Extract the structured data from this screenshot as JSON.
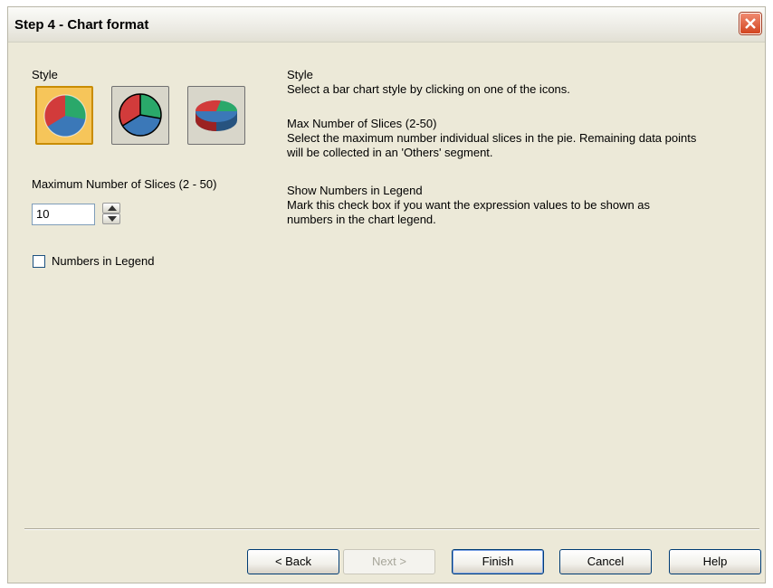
{
  "dialog": {
    "title": "Step 4 - Chart format",
    "close_icon": "close-icon"
  },
  "style": {
    "label": "Style",
    "options": [
      {
        "name": "pie-style-flat-icon",
        "selected": true
      },
      {
        "name": "pie-style-outlined-icon",
        "selected": false
      },
      {
        "name": "pie-style-3d-icon",
        "selected": false
      }
    ]
  },
  "slices": {
    "label": "Maximum Number of Slices (2 - 50)",
    "value": "10"
  },
  "legend": {
    "label": "Numbers in Legend",
    "checked": false
  },
  "help": {
    "style_title": "Style",
    "style_text": "Select a bar chart style by clicking on one of the icons.",
    "slices_title": "Max Number of Slices (2-50)",
    "slices_text_1": "Select the maximum number individual slices in the pie. Remaining data points",
    "slices_text_2": "will be collected in an 'Others' segment.",
    "legend_title": "Show Numbers in Legend",
    "legend_text_1": "Mark this check box if you want the expression values to be shown as",
    "legend_text_2": "numbers in the chart legend."
  },
  "buttons": {
    "back": "< Back",
    "next": "Next >",
    "finish": "Finish",
    "cancel": "Cancel",
    "help": "Help"
  },
  "colors": {
    "pie_red": "#d23b3b",
    "pie_green": "#2aa86a",
    "pie_blue": "#3b78b8",
    "selected_bg": "#f6c55a"
  }
}
